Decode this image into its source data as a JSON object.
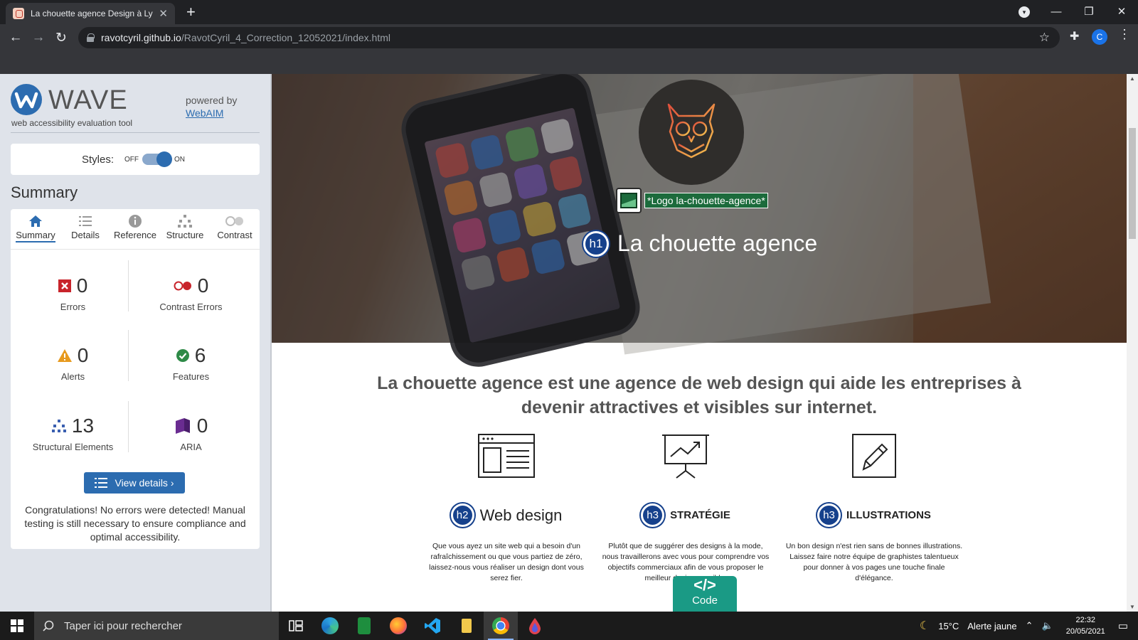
{
  "browser": {
    "tab_title": "La chouette agence Design à Lyo",
    "url_host": "ravotcyril.github.io",
    "url_path": "/RavotCyril_4_Correction_12052021/index.html",
    "profile_initial": "C"
  },
  "wave": {
    "name": "WAVE",
    "tagline": "web accessibility evaluation tool",
    "powered_by": "powered by",
    "webaim_link": "WebAIM",
    "styles_label": "Styles:",
    "styles_off": "OFF",
    "styles_on": "ON",
    "summary_heading": "Summary",
    "tabs": [
      {
        "label": "Summary",
        "icon": "home-icon"
      },
      {
        "label": "Details",
        "icon": "list-icon"
      },
      {
        "label": "Reference",
        "icon": "info-icon"
      },
      {
        "label": "Structure",
        "icon": "hierarchy-icon"
      },
      {
        "label": "Contrast",
        "icon": "contrast-icon"
      }
    ],
    "stats": {
      "errors": {
        "value": "0",
        "label": "Errors"
      },
      "contrast_errors": {
        "value": "0",
        "label": "Contrast Errors"
      },
      "alerts": {
        "value": "0",
        "label": "Alerts"
      },
      "features": {
        "value": "6",
        "label": "Features"
      },
      "structural": {
        "value": "13",
        "label": "Structural Elements"
      },
      "aria": {
        "value": "0",
        "label": "ARIA"
      }
    },
    "view_details": "View details ›",
    "congrats": "Congratulations! No errors were detected! Manual testing is still necessary to ensure compliance and optimal accessibility."
  },
  "page": {
    "logo_alt": "*Logo la-chouette-agence*",
    "h1_badge": "h1",
    "h1": "La chouette agence",
    "lead": "La chouette agence est une agence de web design qui aide les entreprises à devenir attractives et visibles sur internet.",
    "cards": [
      {
        "badge": "h2",
        "title": "Web design",
        "text": "Que vous ayez un site web qui a besoin d'un rafraîchissement ou que vous partiez de zéro, laissez-nous vous réaliser un design dont vous serez fier."
      },
      {
        "badge": "h3",
        "title": "STRATÉGIE",
        "text": "Plutôt que de suggérer des designs à la mode, nous travaillerons avec vous pour comprendre vos objectifs commerciaux afin de vous proposer le meilleur design possible."
      },
      {
        "badge": "h3",
        "title": "ILLUSTRATIONS",
        "text": "Un bon design n'est rien sans de bonnes illustrations. Laissez faire notre équipe de graphistes talentueux pour donner à vos pages une touche finale d'élégance."
      }
    ],
    "code_symbol": "</>",
    "code_label": "Code"
  },
  "taskbar": {
    "search_placeholder": "Taper ici pour rechercher",
    "weather": "15°C",
    "weather_alert": "Alerte jaune",
    "time": "22:32",
    "date": "20/05/2021"
  },
  "colors": {
    "wave_blue": "#2c6cb0",
    "wave_bg": "#dfe3ea",
    "heading_badge": "#16418c",
    "alt_green": "#1c6b3c",
    "code_teal": "#1a9a85"
  }
}
